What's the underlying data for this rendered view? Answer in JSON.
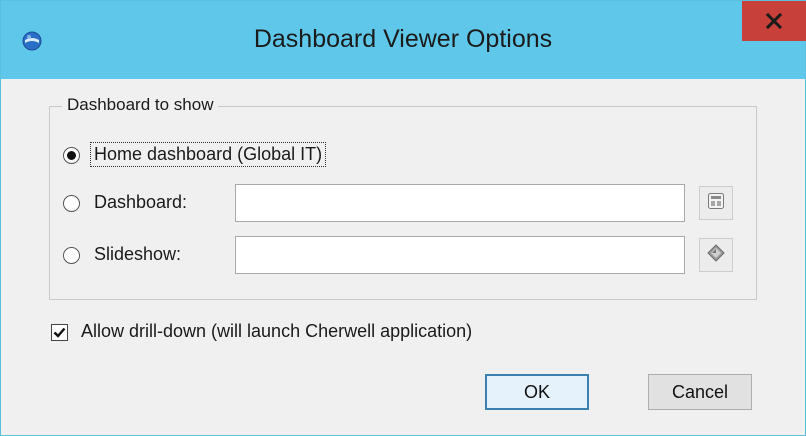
{
  "window": {
    "title": "Dashboard Viewer Options",
    "app_icon": "cherwell-globe-icon",
    "close_label": "x",
    "accent": "#5fc8ea",
    "close_color": "#c7403a"
  },
  "group": {
    "legend": "Dashboard to show",
    "options": [
      {
        "label": "Home dashboard (Global IT)",
        "selected": true
      },
      {
        "label": "Dashboard:",
        "selected": false,
        "value": "",
        "button_icon": "dashboard-picker-icon"
      },
      {
        "label": "Slideshow:",
        "selected": false,
        "value": "",
        "button_icon": "slideshow-picker-icon"
      }
    ]
  },
  "drilldown": {
    "label": "Allow drill-down (will launch Cherwell application)",
    "checked": true
  },
  "buttons": {
    "ok": "OK",
    "cancel": "Cancel"
  }
}
